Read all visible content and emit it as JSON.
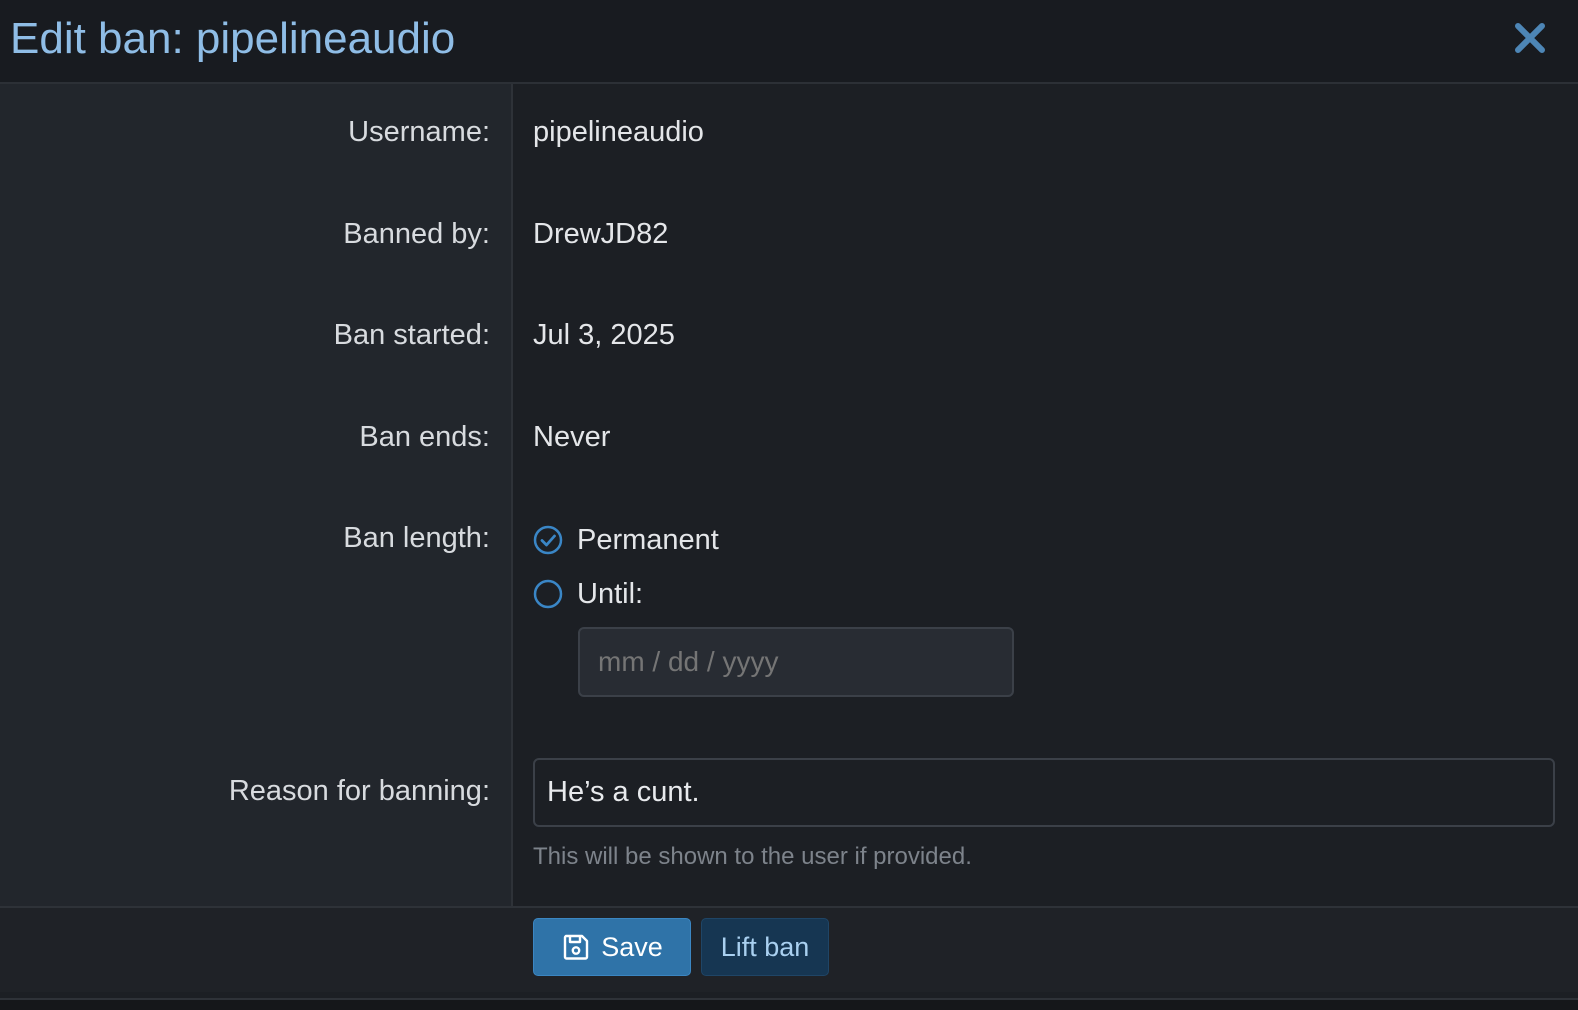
{
  "dialog": {
    "title": "Edit ban: pipelineaudio",
    "close_icon": "close-icon"
  },
  "fields": {
    "username": {
      "label": "Username:",
      "value": "pipelineaudio"
    },
    "banned_by": {
      "label": "Banned by:",
      "value": "DrewJD82"
    },
    "ban_started": {
      "label": "Ban started:",
      "value": "Jul 3, 2025"
    },
    "ban_ends": {
      "label": "Ban ends:",
      "value": "Never"
    },
    "ban_length": {
      "label": "Ban length:",
      "options": [
        {
          "label": "Permanent",
          "selected": true
        },
        {
          "label": "Until:",
          "selected": false
        }
      ],
      "date_placeholder": "mm / dd / yyyy",
      "date_value": ""
    },
    "reason": {
      "label": "Reason for banning:",
      "value": "He’s a cunt.",
      "hint": "This will be shown to the user if provided."
    }
  },
  "footer": {
    "save_label": "Save",
    "save_icon": "save-icon",
    "lift_label": "Lift ban"
  },
  "colors": {
    "accent": "#2f73a8",
    "title": "#8fbde6",
    "radio": "#3a86c6"
  }
}
